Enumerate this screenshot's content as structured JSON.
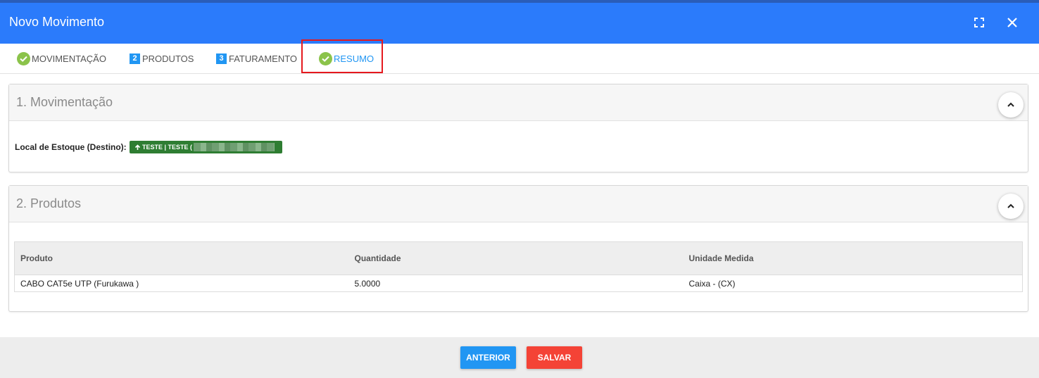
{
  "window": {
    "title": "Novo Movimento",
    "fullscreen_icon": "fullscreen-icon",
    "close_icon": "close-icon"
  },
  "tabs": [
    {
      "label": "MOVIMENTAÇÃO",
      "marker": "check",
      "active": false
    },
    {
      "label": "PRODUTOS",
      "marker": "2",
      "active": false
    },
    {
      "label": "FATURAMENTO",
      "marker": "3",
      "active": false
    },
    {
      "label": "RESUMO",
      "marker": "check",
      "active": true
    }
  ],
  "section_movimentacao": {
    "title": "1. Movimentação",
    "field_label": "Local de Estoque (Destino):",
    "destination_badge": "TESTE | TESTE (",
    "badge_icon": "arrow-up-icon",
    "badge_color": "#2e7d32"
  },
  "section_produtos": {
    "title": "2. Produtos",
    "columns": [
      "Produto",
      "Quantidade",
      "Unidade Medida"
    ],
    "rows": [
      [
        "CABO CAT5e UTP (Furukawa )",
        "5.0000",
        "Caixa - (CX)"
      ]
    ]
  },
  "footer": {
    "prev_label": "ANTERIOR",
    "save_label": "SALVAR"
  },
  "colors": {
    "header": "#2b7bfb",
    "accent": "#2196f3",
    "success": "#8bc34a",
    "danger": "#f44336",
    "highlight": "#e5191e"
  }
}
